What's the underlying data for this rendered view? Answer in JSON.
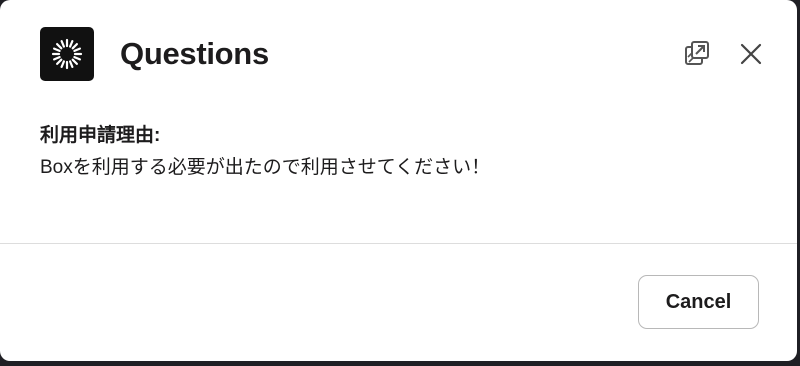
{
  "modal": {
    "title": "Questions",
    "app_icon": "sunburst-logo-icon",
    "actions": {
      "open_in_new_icon": "open-in-new-window-icon",
      "close_icon": "close-icon"
    }
  },
  "content": {
    "label": "利用申請理由:",
    "value": "Boxを利用する必要が出たので利用させてください！"
  },
  "footer": {
    "cancel_label": "Cancel"
  },
  "colors": {
    "background": "#ffffff",
    "text": "#1d1c1d",
    "app_icon_bg": "#111111"
  }
}
